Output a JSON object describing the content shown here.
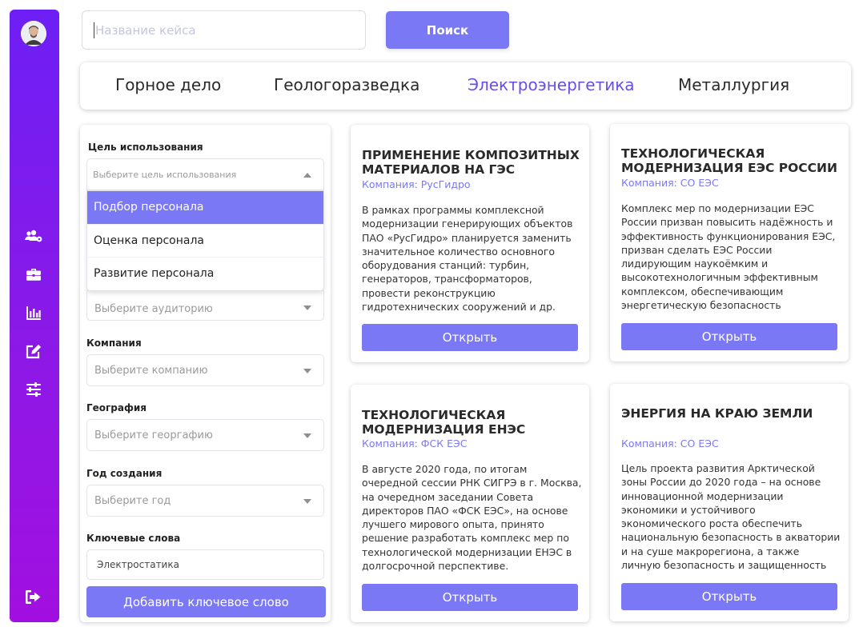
{
  "search": {
    "placeholder": "Название кейса",
    "button_label": "Поиск"
  },
  "tabs": [
    {
      "label": "Горное дело",
      "active": false
    },
    {
      "label": "Геологоразведка",
      "active": false
    },
    {
      "label": "Электроэнергетика",
      "active": true
    },
    {
      "label": "Металлургия",
      "active": false
    }
  ],
  "filters": {
    "purpose": {
      "label": "Цель использования",
      "placeholder": "Выберите цель использования",
      "options": [
        "Подбор персонала",
        "Оценка персонала",
        "Развитие персонала"
      ],
      "highlighted": "Подбор персонала"
    },
    "audience": {
      "placeholder": "Выберите аудиторию"
    },
    "company": {
      "label": "Компания",
      "placeholder": "Выберите компанию"
    },
    "geography": {
      "label": "География",
      "placeholder": "Выберите георгафию"
    },
    "year": {
      "label": "Год создания",
      "placeholder": "Выберите год"
    },
    "keywords": {
      "label": "Ключевые слова",
      "value": "Электростатика",
      "add_button": "Добавить ключевое слово"
    }
  },
  "cards": [
    {
      "title": "ПРИМЕНЕНИЕ КОМПОЗИТНЫХ МАТЕРИАЛОВ НА ГЭС",
      "company": "Компания: РусГидро",
      "description": "В рамках программы комплексной модернизации генерирующих объектов ПАО «РусГидро» планируется заменить значительное количество основного оборудования станций: турбин, генераторов, трансформаторов, провести реконструкцию гидротехнических сооружений и др.",
      "button": "Открыть"
    },
    {
      "title": "ТЕХНОЛОГИЧЕСКАЯ МОДЕРНИЗАЦИЯ ЕЭС РОССИИ",
      "company": "Компания: СО ЕЭС",
      "description": "Комплекс мер по модернизации ЕЭС России призван повысить надёжность и эффективность функционирования ЕЭС, призван сделать ЕЭС России лидирующим наукоёмким и высокотехнологичным эффективным комплексом, обеспечивающим энергетическую безопасность государства в долгосрочной",
      "button": "Открыть"
    },
    {
      "title": "ТЕХНОЛОГИЧЕСКАЯ МОДЕРНИЗАЦИЯ ЕНЭС",
      "company": "Компания: ФСК ЕЭС",
      "description": "В августе 2020 года, по итогам очередной сессии РНК СИГРЭ в г. Москва, на очередном заседании Совета директоров ПАО «ФСК ЕЭС», на основе лучшего мирового опыта, принято решение разработать комплекс мер по технологической модернизации ЕНЭС в долгосрочной перспективе.",
      "button": "Открыть"
    },
    {
      "title": "ЭНЕРГИЯ НА КРАЮ ЗЕМЛИ",
      "company": "Компания: СО ЕЭС",
      "description": "Цель проекта развития Арктической зоны России до 2020 года – на основе инновационной модернизации экономики и устойчивого экономического роста обеспечить национальную безопасность в акватории и на суше макрорегиона, а также личную безопасность и защищенность проживающего населения.",
      "button": "Открыть"
    }
  ],
  "icons": {
    "sidebar": [
      "users-cog-icon",
      "briefcase-icon",
      "chart-bar-icon",
      "edit-icon",
      "sliders-icon",
      "sign-out-icon"
    ]
  },
  "colors": {
    "accent": "#7b78f6",
    "active_tab": "#6a4de9",
    "sidebar_top": "#6d1ff5",
    "sidebar_bottom": "#a10fe0"
  }
}
